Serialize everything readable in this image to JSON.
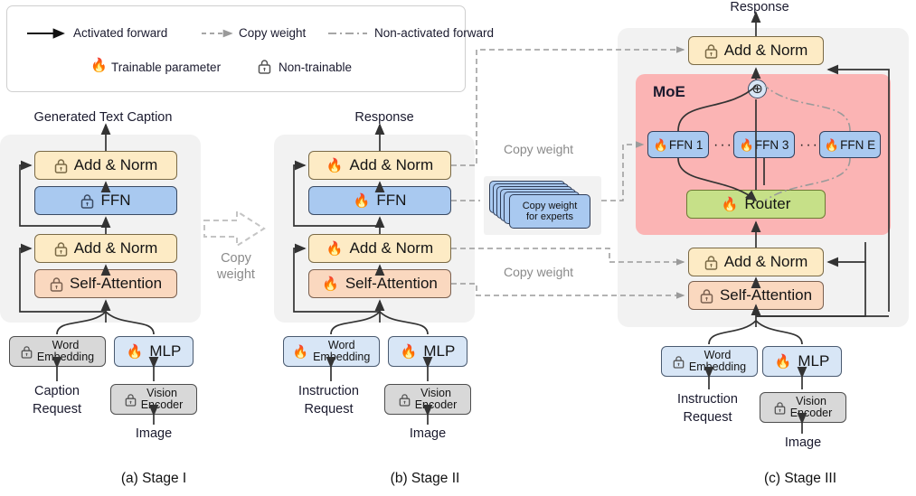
{
  "legend": {
    "items": [
      {
        "id": "activated-forward",
        "label": "Activated forward",
        "style": "solid-arrow"
      },
      {
        "id": "copy-weight",
        "label": "Copy weight",
        "style": "dashed-arrow"
      },
      {
        "id": "non-activated-forward",
        "label": "Non-activated forward",
        "style": "dashdot-line"
      },
      {
        "id": "trainable-parameter",
        "label": "Trainable parameter",
        "icon": "flame-icon"
      },
      {
        "id": "non-trainable",
        "label": "Non-trainable",
        "icon": "lock-icon"
      }
    ]
  },
  "stage1": {
    "caption": "(a) Stage I",
    "output_label": "Generated Text Caption",
    "blocks": [
      {
        "id": "add-norm-top",
        "label": "Add & Norm",
        "state": "locked",
        "color": "yellow"
      },
      {
        "id": "ffn",
        "label": "FFN",
        "state": "locked",
        "color": "blue"
      },
      {
        "id": "add-norm-bottom",
        "label": "Add & Norm",
        "state": "locked",
        "color": "yellow"
      },
      {
        "id": "self-attention",
        "label": "Self-Attention",
        "state": "locked",
        "color": "peach"
      }
    ],
    "word_embedding": {
      "label": "Word\nEmbedding",
      "line1": "Word",
      "line2": "Embedding",
      "state": "locked"
    },
    "mlp": {
      "label": "MLP",
      "state": "trainable"
    },
    "vision_encoder": {
      "line1": "Vision",
      "line2": "Encoder",
      "state": "locked"
    },
    "request_line1": "Caption",
    "request_line2": "Request",
    "image_label": "Image"
  },
  "stage2": {
    "caption": "(b) Stage II",
    "output_label": "Response",
    "blocks": [
      {
        "id": "add-norm-top",
        "label": "Add & Norm",
        "state": "trainable",
        "color": "yellow"
      },
      {
        "id": "ffn",
        "label": "FFN",
        "state": "trainable",
        "color": "blue"
      },
      {
        "id": "add-norm-bottom",
        "label": "Add & Norm",
        "state": "trainable",
        "color": "yellow"
      },
      {
        "id": "self-attention",
        "label": "Self-Attention",
        "state": "trainable",
        "color": "peach"
      }
    ],
    "word_embedding": {
      "line1": "Word",
      "line2": "Embedding",
      "state": "trainable"
    },
    "mlp": {
      "label": "MLP",
      "state": "trainable"
    },
    "vision_encoder": {
      "line1": "Vision",
      "line2": "Encoder",
      "state": "locked"
    },
    "request_line1": "Instruction",
    "request_line2": "Request",
    "image_label": "Image"
  },
  "transfer": {
    "arrow_label_line1": "Copy",
    "arrow_label_line2": "weight",
    "copy_weight_top": "Copy weight",
    "copy_weight_bottom": "Copy weight",
    "experts_stack_line1": "Copy weight",
    "experts_stack_line2": "for experts"
  },
  "stage3": {
    "caption": "(c) Stage III",
    "output_label": "Response",
    "add_norm_top": {
      "label": "Add & Norm",
      "state": "locked"
    },
    "add_norm_bottom": {
      "label": "Add & Norm",
      "state": "locked"
    },
    "self_attention": {
      "label": "Self-Attention",
      "state": "locked"
    },
    "moe_label": "MoE",
    "sum_symbol": "⊕",
    "experts": [
      {
        "id": "ffn-1",
        "label": "FFN 1",
        "state": "trainable",
        "activated": true
      },
      {
        "id": "ffn-3",
        "label": "FFN 3",
        "state": "trainable",
        "activated": true
      },
      {
        "id": "ffn-e",
        "label": "FFN E",
        "state": "trainable",
        "activated": false
      }
    ],
    "ellipsis": "···",
    "router": {
      "label": "Router",
      "state": "trainable"
    },
    "word_embedding": {
      "line1": "Word",
      "line2": "Embedding",
      "state": "locked"
    },
    "mlp": {
      "label": "MLP",
      "state": "trainable"
    },
    "vision_encoder": {
      "line1": "Vision",
      "line2": "Encoder",
      "state": "locked"
    },
    "request_line1": "Instruction",
    "request_line2": "Request",
    "image_label": "Image"
  },
  "colors": {
    "panel": "#f2f2f2",
    "moe": "#fbb4b4",
    "yellow": "#fdebc5",
    "blue": "#a9c9f0",
    "peach": "#fad8bf",
    "gray": "#d8d8d8",
    "light_blue": "#d8e6f6",
    "green": "#c6e088",
    "line": "#3a3a3a",
    "dashed": "#9a9a9a"
  }
}
